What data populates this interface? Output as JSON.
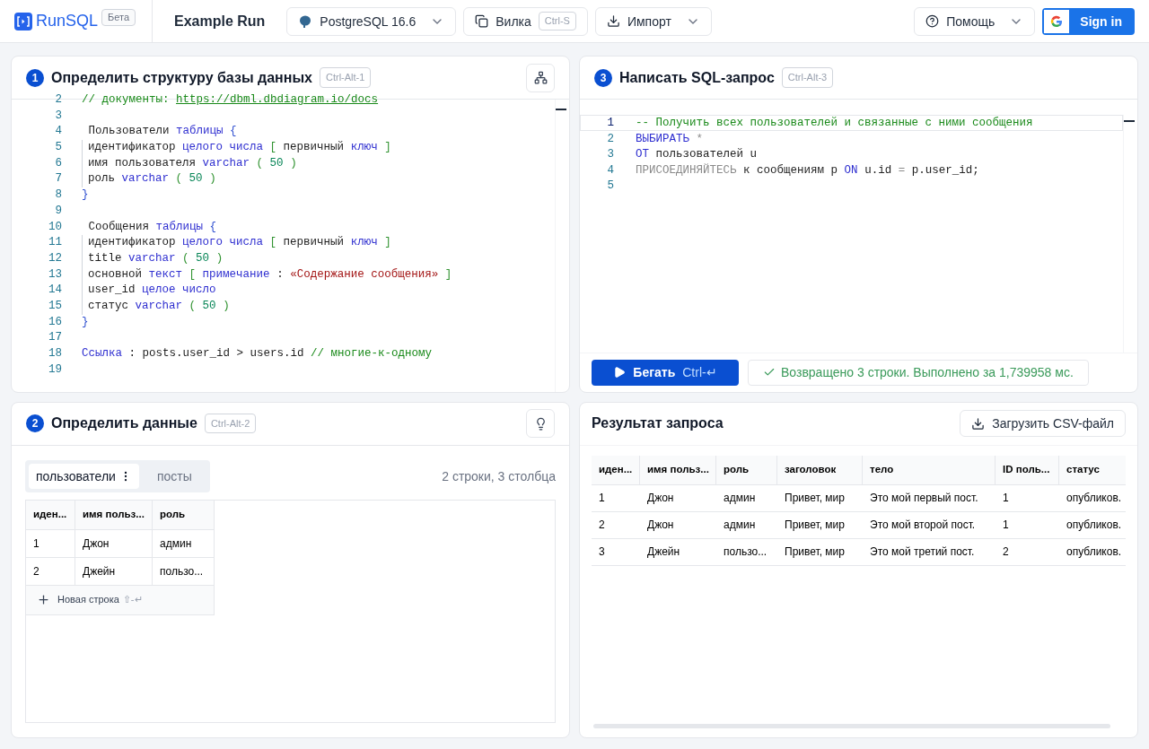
{
  "header": {
    "logo": "RunSQL",
    "badge": "Бета",
    "title": "Example Run",
    "database": "PostgreSQL 16.6",
    "fork": {
      "label": "Вилка",
      "shortcut": "Ctrl-S"
    },
    "import": "Импорт",
    "help": "Помощь",
    "sign_in": "Sign in"
  },
  "schema_panel": {
    "step": "1",
    "title": "Определить структуру базы данных",
    "shortcut": "Ctrl-Alt-1",
    "lines": [
      {
        "number": "2",
        "indented": false,
        "tokens": [
          {
            "kind": "comment",
            "text": "// документы:"
          },
          {
            "kind": "link",
            "text": "https://dbml.dbdiagram.io/docs"
          }
        ]
      },
      {
        "number": "3",
        "indented": false
      },
      {
        "number": "4",
        "indented": false,
        "tokens": [
          {
            "kind": "plain",
            "text": " Пользователи"
          },
          {
            "kind": "keyword",
            "text": "таблицы"
          },
          {
            "kind": "brace",
            "text": "{"
          }
        ]
      },
      {
        "number": "5",
        "indented": true,
        "tokens": [
          {
            "kind": "plain",
            "text": "идентификатор"
          },
          {
            "kind": "keyword",
            "text": "целого числа"
          },
          {
            "kind": "bracket",
            "text": "["
          },
          {
            "kind": "plain",
            "text": "первичный"
          },
          {
            "kind": "keyword",
            "text": "ключ"
          },
          {
            "kind": "bracket",
            "text": "]"
          }
        ]
      },
      {
        "number": "6",
        "indented": true,
        "tokens": [
          {
            "kind": "plain",
            "text": "имя пользователя"
          },
          {
            "kind": "keyword",
            "text": "varchar"
          },
          {
            "kind": "bracket",
            "text": "("
          },
          {
            "kind": "number",
            "text": "50"
          },
          {
            "kind": "bracket",
            "text": ")"
          }
        ]
      },
      {
        "number": "7",
        "indented": true,
        "tokens": [
          {
            "kind": "plain",
            "text": "роль"
          },
          {
            "kind": "keyword",
            "text": "varchar"
          },
          {
            "kind": "bracket",
            "text": "("
          },
          {
            "kind": "number",
            "text": "50"
          },
          {
            "kind": "bracket",
            "text": ")"
          }
        ]
      },
      {
        "number": "8",
        "indented": false,
        "tokens": [
          {
            "kind": "brace",
            "text": "}"
          }
        ]
      },
      {
        "number": "9",
        "indented": false
      },
      {
        "number": "10",
        "indented": false,
        "tokens": [
          {
            "kind": "plain",
            "text": " Сообщения"
          },
          {
            "kind": "keyword",
            "text": "таблицы"
          },
          {
            "kind": "brace",
            "text": "{"
          }
        ]
      },
      {
        "number": "11",
        "indented": true,
        "tokens": [
          {
            "kind": "plain",
            "text": "идентификатор"
          },
          {
            "kind": "keyword",
            "text": "целого числа"
          },
          {
            "kind": "bracket",
            "text": "["
          },
          {
            "kind": "plain",
            "text": "первичный"
          },
          {
            "kind": "keyword",
            "text": "ключ"
          },
          {
            "kind": "bracket",
            "text": "]"
          }
        ]
      },
      {
        "number": "12",
        "indented": true,
        "tokens": [
          {
            "kind": "plain",
            "text": "title"
          },
          {
            "kind": "keyword",
            "text": "varchar"
          },
          {
            "kind": "bracket",
            "text": "("
          },
          {
            "kind": "number",
            "text": "50"
          },
          {
            "kind": "bracket",
            "text": ")"
          }
        ]
      },
      {
        "number": "13",
        "indented": true,
        "tokens": [
          {
            "kind": "plain",
            "text": "основной"
          },
          {
            "kind": "keyword",
            "text": "текст"
          },
          {
            "kind": "bracket",
            "text": "["
          },
          {
            "kind": "keyword",
            "text": "примечание"
          },
          {
            "kind": "plain",
            "text": ":"
          },
          {
            "kind": "string",
            "text": "«Содержание сообщения»"
          },
          {
            "kind": "bracket",
            "text": "]"
          }
        ]
      },
      {
        "number": "14",
        "indented": true,
        "tokens": [
          {
            "kind": "plain",
            "text": "user_id"
          },
          {
            "kind": "keyword",
            "text": "целое число"
          }
        ]
      },
      {
        "number": "15",
        "indented": true,
        "tokens": [
          {
            "kind": "plain",
            "text": "статус"
          },
          {
            "kind": "keyword",
            "text": "varchar"
          },
          {
            "kind": "bracket",
            "text": "("
          },
          {
            "kind": "number",
            "text": "50"
          },
          {
            "kind": "bracket",
            "text": ")"
          }
        ]
      },
      {
        "number": "16",
        "indented": false,
        "tokens": [
          {
            "kind": "brace",
            "text": "}"
          }
        ]
      },
      {
        "number": "17",
        "indented": false
      },
      {
        "number": "18",
        "indented": false,
        "tokens": [
          {
            "kind": "keyword",
            "text": "Ссылка"
          },
          {
            "kind": "plain",
            "text": ": posts.user_id > users.id"
          },
          {
            "kind": "comment",
            "text": "// многие-к-одному"
          }
        ]
      },
      {
        "number": "19",
        "indented": false
      }
    ]
  },
  "query_panel": {
    "step": "3",
    "title": "Написать SQL-запрос",
    "shortcut": "Ctrl-Alt-3",
    "lines": [
      {
        "number": "1",
        "selected": true,
        "tokens": [
          {
            "kind": "comment",
            "text": "-- Получить всех пользователей и связанные с ними сообщения"
          }
        ]
      },
      {
        "number": "2",
        "selected": false,
        "tokens": [
          {
            "kind": "keyword",
            "text": "ВЫБИРАТЬ"
          },
          {
            "kind": "muted",
            "text": "*"
          }
        ]
      },
      {
        "number": "3",
        "selected": false,
        "tokens": [
          {
            "kind": "keyword",
            "text": "ОТ"
          },
          {
            "kind": "plain",
            "text": "пользователей u"
          }
        ]
      },
      {
        "number": "4",
        "selected": false,
        "tokens": [
          {
            "kind": "muted",
            "text": "ПРИСОЕДИНЯЙТЕСЬ"
          },
          {
            "kind": "plain",
            "text": "к сообщениям p"
          },
          {
            "kind": "keyword",
            "text": "ON"
          },
          {
            "kind": "plain",
            "text": "u.id"
          },
          {
            "kind": "muted",
            "text": "="
          },
          {
            "kind": "plain",
            "text": "p.user_id;"
          }
        ]
      },
      {
        "number": "5",
        "selected": false
      }
    ],
    "run": {
      "label": "Бегать",
      "shortcut": "Ctrl-↵"
    },
    "status": "Возвращено 3 строки. Выполнено за 1,739958 мс."
  },
  "data_panel": {
    "step": "2",
    "title": "Определить данные",
    "shortcut": "Ctrl-Alt-2",
    "tabs": [
      {
        "label": "пользователи",
        "selected": true
      },
      {
        "label": "посты",
        "selected": false
      }
    ],
    "summary": "2 строки, 3 столбца",
    "columns": [
      "иден...",
      "имя польз...",
      "роль"
    ],
    "rows": [
      [
        "1",
        "Джон",
        "админ"
      ],
      [
        "2",
        "Джейн",
        "пользо..."
      ]
    ],
    "new_row": {
      "label": "Новая строка",
      "shortcut": "⇧-↵"
    }
  },
  "result_panel": {
    "title": "Результат запроса",
    "download": "Загрузить CSV-файл",
    "columns": [
      "иден...",
      "имя польз...",
      "роль",
      "заголовок",
      "тело",
      "ID поль...",
      "статус"
    ],
    "rows": [
      [
        "1",
        "Джон",
        "админ",
        "Привет, мир",
        "Это мой первый пост.",
        "1",
        "опубликов."
      ],
      [
        "2",
        "Джон",
        "админ",
        "Привет, мир",
        "Это мой второй пост.",
        "1",
        "опубликов."
      ],
      [
        "3",
        "Джейн",
        "пользо...",
        "Привет, мир",
        "Это мой третий пост.",
        "2",
        "опубликов."
      ]
    ]
  }
}
